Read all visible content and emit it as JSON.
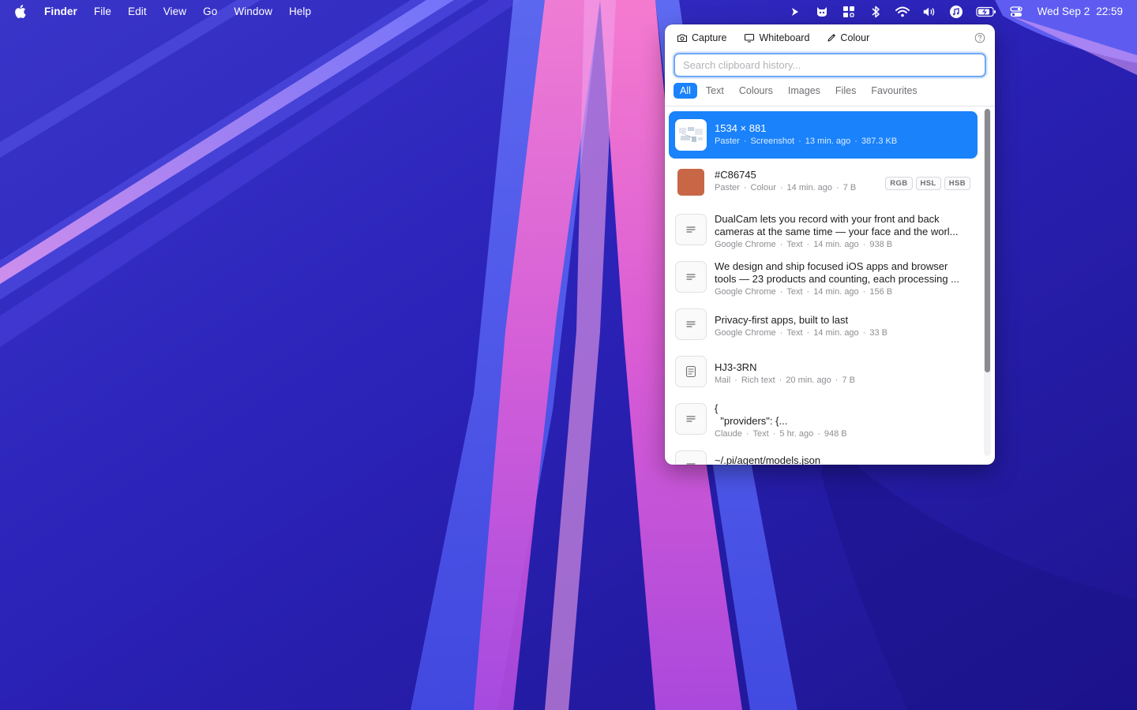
{
  "menubar": {
    "app_name": "Finder",
    "menus": [
      "File",
      "Edit",
      "View",
      "Go",
      "Window",
      "Help"
    ],
    "status_icons": [
      "terminal-prompt-icon",
      "cat-app-icon",
      "grid-app-icon",
      "bluetooth-icon",
      "wifi-icon",
      "volume-icon",
      "music-icon",
      "battery-charging-icon",
      "control-center-icon"
    ],
    "date": "Wed Sep 2",
    "time": "22:59"
  },
  "popover": {
    "toolbar": {
      "capture_label": "Capture",
      "whiteboard_label": "Whiteboard",
      "colour_label": "Colour"
    },
    "search": {
      "placeholder": "Search clipboard history...",
      "value": ""
    },
    "filters": [
      "All",
      "Text",
      "Colours",
      "Images",
      "Files",
      "Favourites"
    ],
    "active_filter": "All",
    "items": [
      {
        "title": "1534 × 881",
        "meta": [
          "Paster",
          "Screenshot",
          "13 min. ago",
          "387.3 KB"
        ],
        "kind": "screenshot",
        "selected": true
      },
      {
        "title": "#C86745",
        "meta": [
          "Paster",
          "Colour",
          "14 min. ago",
          "7 B"
        ],
        "kind": "colour",
        "swatch": "#C86745",
        "badges": [
          "RGB",
          "HSL",
          "HSB"
        ]
      },
      {
        "title_lines": [
          "DualCam lets you record with your front and back",
          "cameras at the same time — your face and the worl..."
        ],
        "meta": [
          "Google Chrome",
          "Text",
          "14 min. ago",
          "938 B"
        ],
        "kind": "text"
      },
      {
        "title_lines": [
          "We design and ship focused iOS apps and browser",
          "tools — 23 products and counting, each processing ..."
        ],
        "meta": [
          "Google Chrome",
          "Text",
          "14 min. ago",
          "156 B"
        ],
        "kind": "text"
      },
      {
        "title": "Privacy-first apps, built to last",
        "meta": [
          "Google Chrome",
          "Text",
          "14 min. ago",
          "33 B"
        ],
        "kind": "text"
      },
      {
        "title": "HJ3-3RN",
        "meta": [
          "Mail",
          "Rich text",
          "20 min. ago",
          "7 B"
        ],
        "kind": "rich-text"
      },
      {
        "title_lines": [
          "{",
          "  \"providers\": {..."
        ],
        "meta": [
          "Claude",
          "Text",
          "5 hr. ago",
          "948 B"
        ],
        "kind": "text"
      },
      {
        "title": "~/.pi/agent/models.json",
        "meta": [],
        "kind": "text"
      }
    ]
  },
  "colors": {
    "accent": "#1A82FB",
    "swatch": "#C86745"
  }
}
